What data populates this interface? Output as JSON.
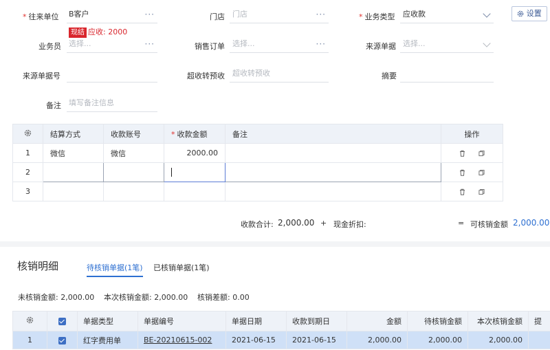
{
  "form": {
    "partner_label": "往来单位",
    "partner_value": "B客户",
    "partner_badge": "现结",
    "partner_receivable": "应收: 2000",
    "store_label": "门店",
    "store_placeholder": "门店",
    "biztype_label": "业务类型",
    "biztype_value": "应收款",
    "settings_label": "设置",
    "salesman_label": "业务员",
    "salesman_placeholder": "选择...",
    "salesorder_label": "销售订单",
    "salesorder_placeholder": "选择...",
    "sourcedoc_label": "来源单据",
    "sourcedoc_placeholder": "选择...",
    "sourcedocno_label": "来源单据号",
    "overpay_label": "超收转预收",
    "overpay_placeholder": "超收转预收",
    "summary_label": "摘要",
    "remark_label": "备注",
    "remark_placeholder": "填写备注信息"
  },
  "payment_grid": {
    "headers": [
      "结算方式",
      "收款账号",
      "收款金额",
      "备注",
      "操作"
    ],
    "rows": [
      {
        "no": "1",
        "method": "微信",
        "account": "微信",
        "amount": "2000.00",
        "remark": ""
      },
      {
        "no": "2",
        "method": "",
        "account": "",
        "amount": "",
        "remark": ""
      },
      {
        "no": "3",
        "method": "",
        "account": "",
        "amount": "",
        "remark": ""
      }
    ]
  },
  "totals": {
    "received_label": "收款合计:",
    "received_value": "2,000.00",
    "plus": "+",
    "discount_label": "现金折扣:",
    "equals": "=",
    "writeoff_label": "可核销金额",
    "writeoff_value": "2,000.00"
  },
  "writeoff": {
    "title": "核销明细",
    "tab_pending": "待核销单据(1笔)",
    "tab_done": "已核销单据(1笔)",
    "unwritten": "未核销金额: 2,000.00",
    "current": "本次核销金额: 2,000.00",
    "diff": "核销差额: 0.00",
    "headers": [
      "单据类型",
      "单据编号",
      "单据日期",
      "收款到期日",
      "金额",
      "待核销金额",
      "本次核销金额",
      "提"
    ],
    "rows": [
      {
        "no": "1",
        "type": "红字费用单",
        "code": "BE-20210615-002",
        "date": "2021-06-15",
        "due": "2021-06-15",
        "amount": "2,000.00",
        "pending": "2,000.00",
        "current": "2,000.00"
      }
    ]
  },
  "colors": {
    "accent": "#2d6fd1",
    "badge": "#d9262d",
    "header_bg": "#eef2f8",
    "selected_row": "#cfe0f7"
  }
}
